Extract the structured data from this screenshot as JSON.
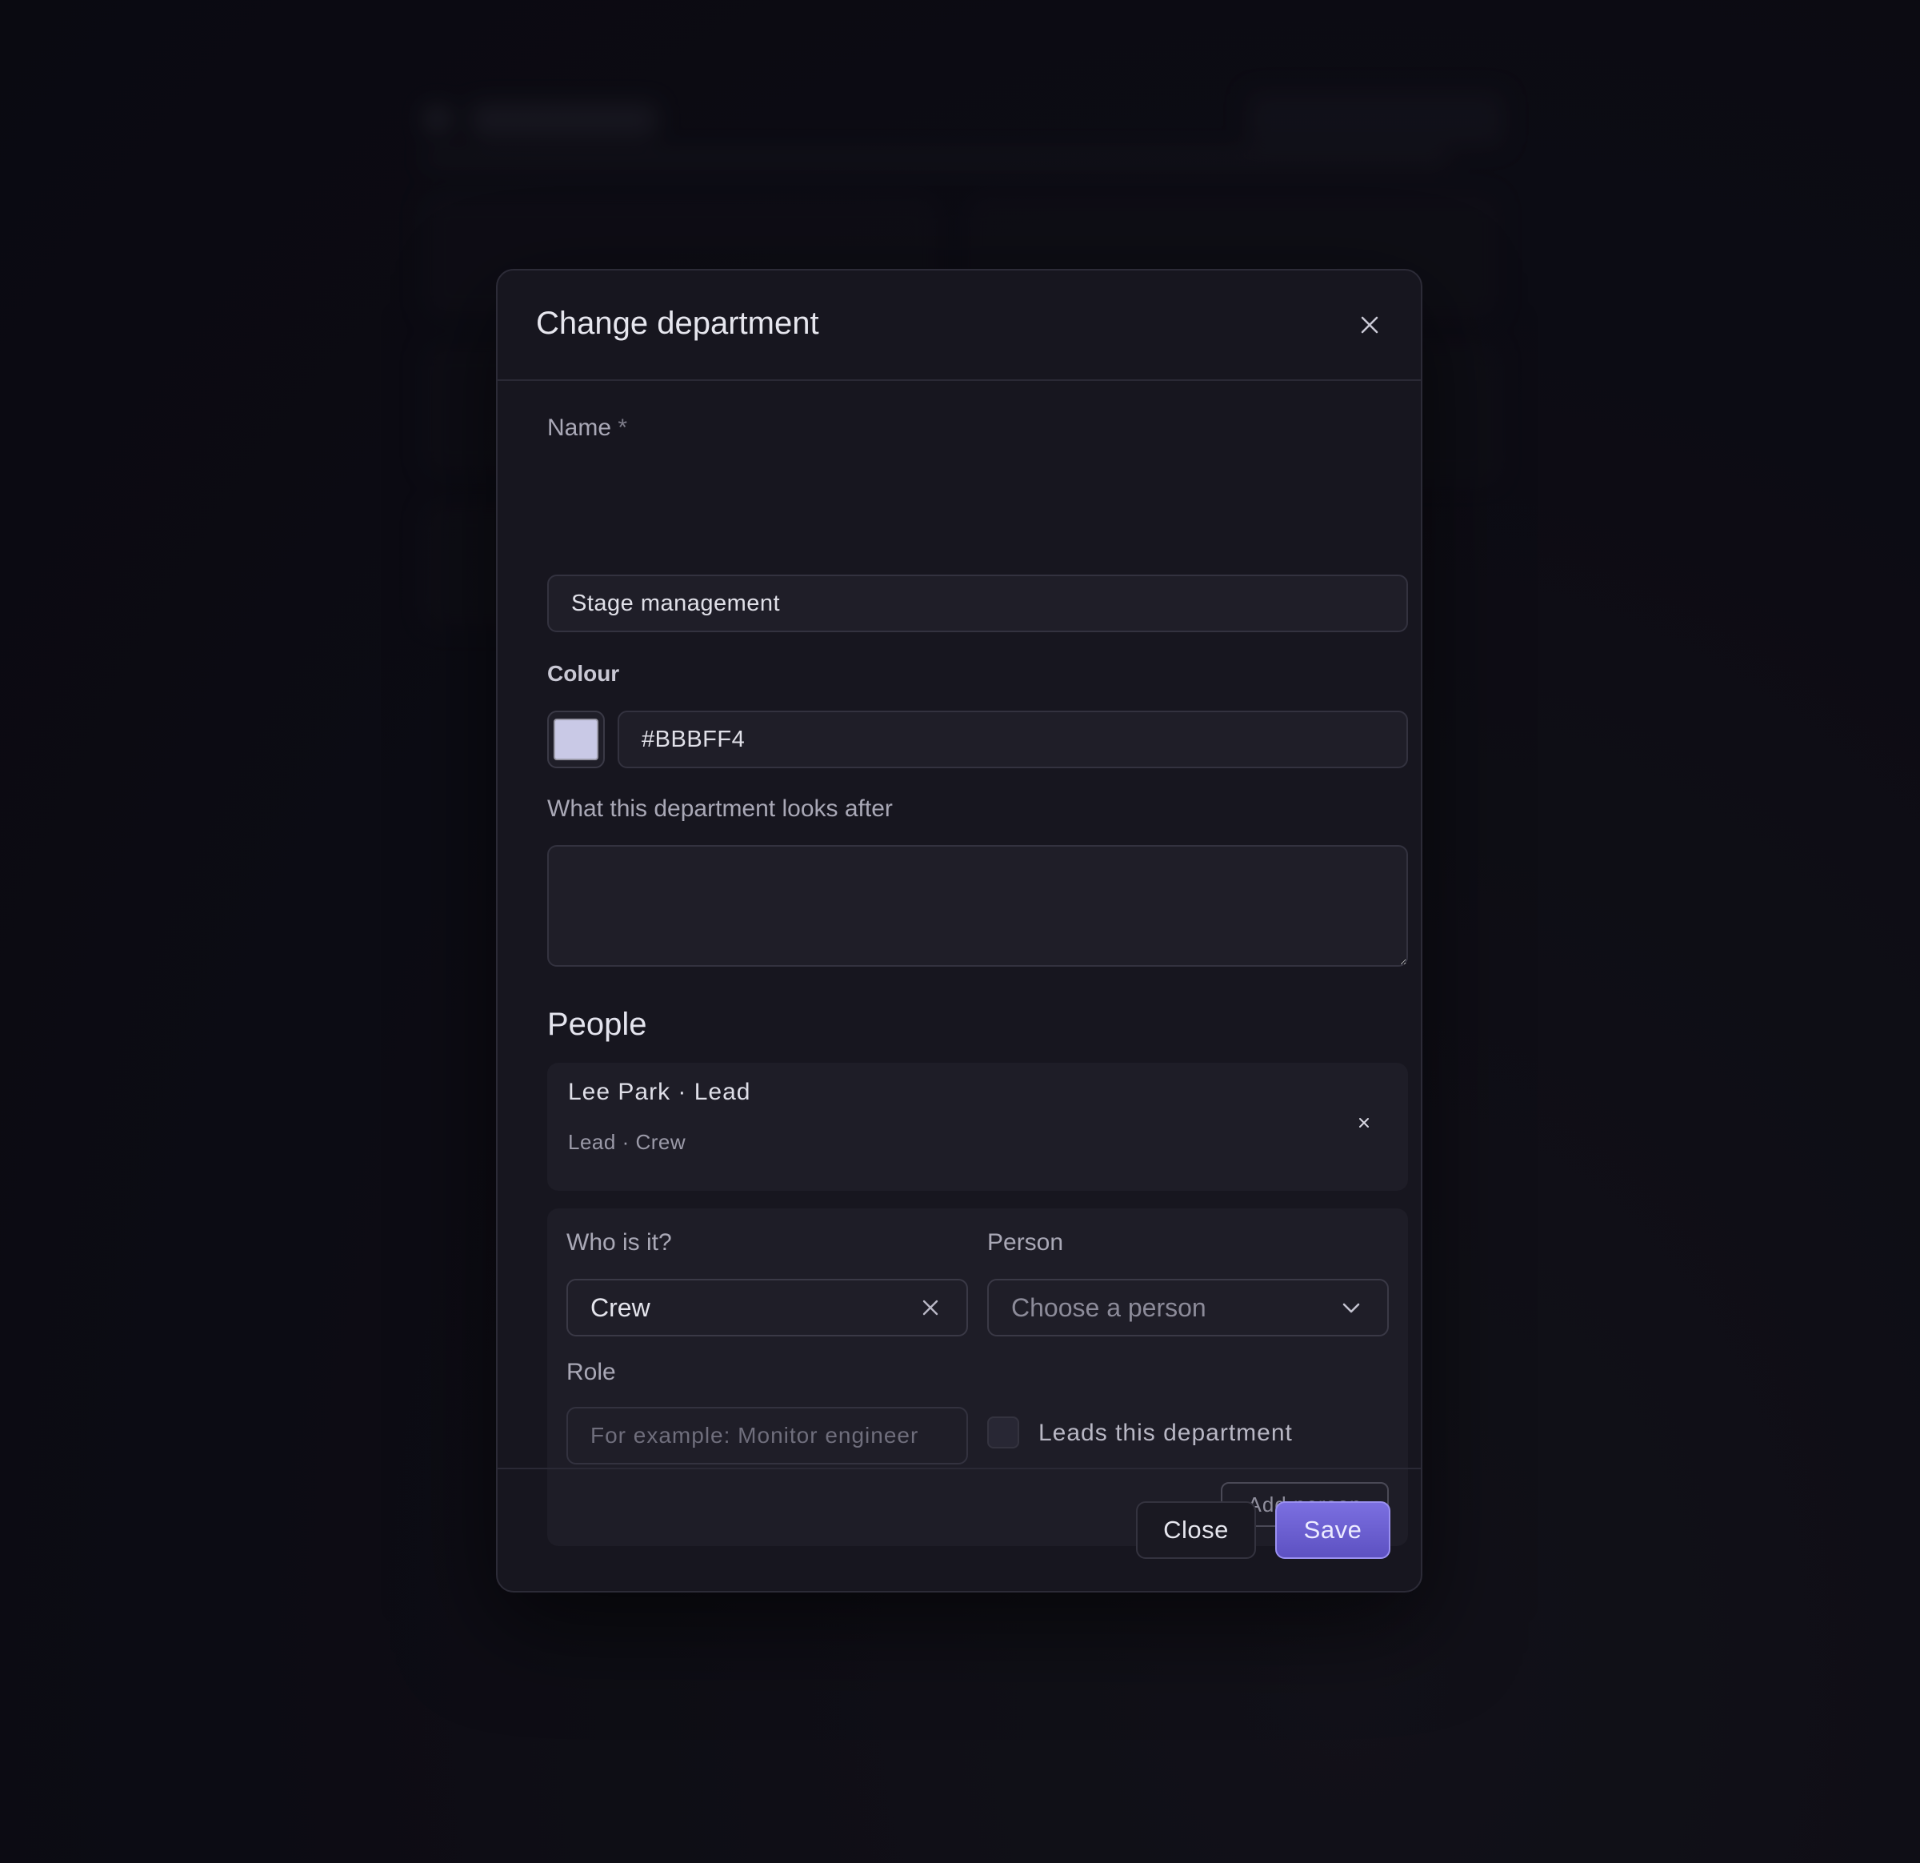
{
  "modal": {
    "title": "Change department",
    "close_icon": "close-icon"
  },
  "form": {
    "name_label": "Name",
    "name_required_mark": "*",
    "name_value": "Stage management",
    "colour_label": "Colour",
    "colour_value": "#BBBFF4",
    "colour_swatch": "#c9c9e6",
    "description_label": "What this department looks after",
    "description_value": ""
  },
  "people": {
    "title": "People",
    "members": [
      {
        "name_line": "Lee Park · Lead",
        "meta_line": "Lead · Crew"
      }
    ]
  },
  "add_person": {
    "who_label": "Who is it?",
    "who_value": "Crew",
    "person_label": "Person",
    "person_placeholder": "Choose a person",
    "role_label": "Role",
    "role_placeholder": "For example: Monitor engineer",
    "leads_label": "Leads this department",
    "leads_checked": false,
    "add_button": "Add person"
  },
  "footer": {
    "close_label": "Close",
    "save_label": "Save"
  },
  "colors": {
    "accent": "#6c60d4",
    "background": "#0f0e17",
    "modal_bg": "#17161f"
  }
}
